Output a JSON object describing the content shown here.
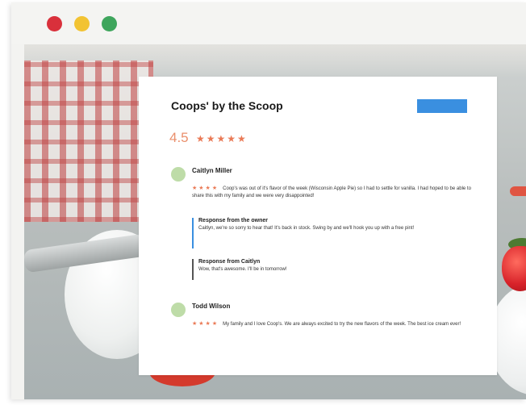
{
  "window": {
    "controls": [
      {
        "name": "close",
        "color": "#d9303b"
      },
      {
        "name": "minimize",
        "color": "#f2c332"
      },
      {
        "name": "maximize",
        "color": "#3ea55c"
      }
    ]
  },
  "business": {
    "name": "Coops' by the Scoop",
    "subtitle": "",
    "cta_label": "",
    "rating": "4.5",
    "stars": "★★★★★",
    "accent_color": "#ea7a56"
  },
  "reviews": [
    {
      "name": "Caitlyn Miller",
      "date": "",
      "stars": "★★★★",
      "text": "Coop's was out of it's flavor of the week (Wisconsin Apple Pie) so I had to settle for vanilla. I had hoped to be able to share this with my family and we were very disappointed!",
      "link": "",
      "responses": [
        {
          "title": "Response from the owner",
          "date": "",
          "text": "Caitlyn, we're so sorry to hear that! It's back in stock. Swing by and we'll hook you up with a free pint!"
        },
        {
          "title": "Response from Caitlyn",
          "date": "",
          "text": "Wow, that's awesome. I'll be in tomorrow!"
        }
      ]
    },
    {
      "name": "Todd Wilson",
      "date": "",
      "stars": "★★★★",
      "text": "My family and I love Coop's. We are always excited to try the new flavors of the week. The best ice cream ever!",
      "link": ""
    }
  ]
}
